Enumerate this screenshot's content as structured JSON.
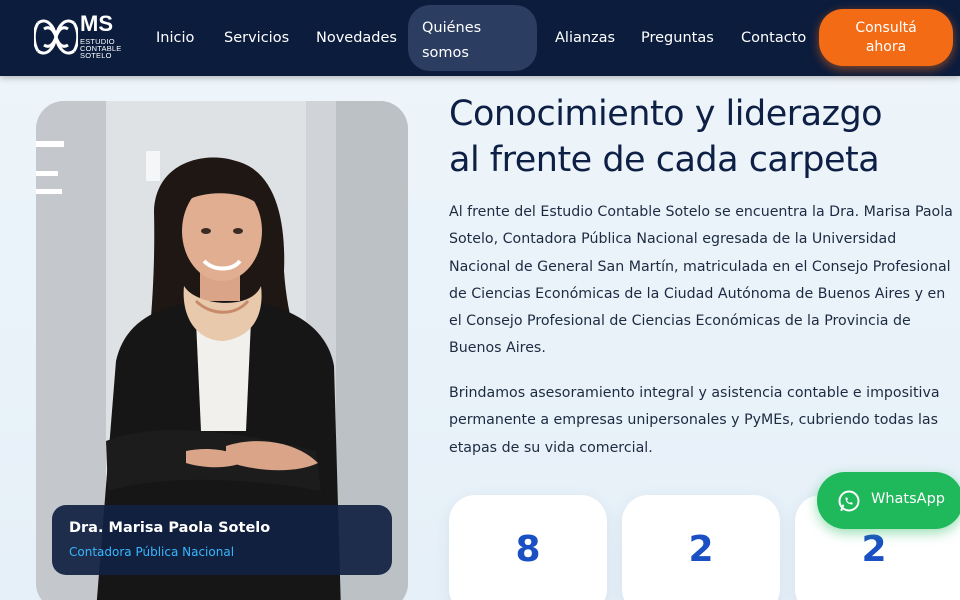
{
  "header": {
    "logo": {
      "monogram": "MS",
      "line1": "ESTUDIO",
      "line2": "CONTABLE",
      "line3": "SOTELO"
    },
    "nav": [
      {
        "label": "Inicio"
      },
      {
        "label": "Servicios"
      },
      {
        "label": "Novedades"
      },
      {
        "label_line1": "Quiénes",
        "label_line2": "somos",
        "active": true
      },
      {
        "label": "Alianzas"
      },
      {
        "label": "Preguntas"
      },
      {
        "label": "Contacto"
      }
    ],
    "cta": {
      "line1": "Consultá",
      "line2": "ahora"
    }
  },
  "profile": {
    "name": "Dra. Marisa Paola Sotelo",
    "role": "Contadora Pública Nacional"
  },
  "main": {
    "title_line1": "Conocimiento y liderazgo",
    "title_line2": "al frente de cada carpeta",
    "paragraph1": "Al frente del Estudio Contable Sotelo se encuentra la Dra. Marisa Paola Sotelo, Contadora Pública Nacional egresada de la Universidad Nacional de General San Martín, matriculada en el Consejo Profesional de Ciencias Económicas de la Ciudad Autónoma de Buenos Aires y en el Consejo Profesional de Ciencias Económicas de la Provincia de Buenos Aires.",
    "paragraph2": "Brindamos asesoramiento integral y asistencia contable e impositiva permanente a empresas unipersonales y PyMEs, cubriendo todas las etapas de su vida comercial."
  },
  "stats": [
    {
      "value": "8"
    },
    {
      "value": "2"
    },
    {
      "value": "2"
    }
  ],
  "whatsapp": {
    "label": "WhatsApp",
    "icon": "whatsapp-icon"
  },
  "colors": {
    "header_bg": "#0b1c3d",
    "accent_orange": "#f36b14",
    "stat_blue": "#1b4fc4",
    "whatsapp_green": "#1fb85a",
    "role_cyan": "#38b6ff"
  }
}
